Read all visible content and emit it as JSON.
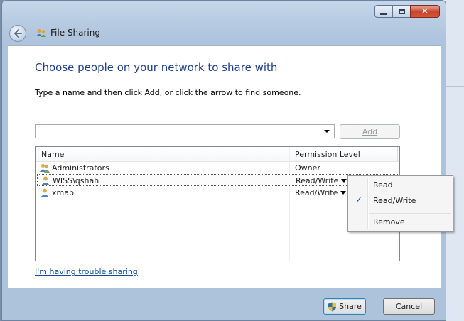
{
  "window": {
    "title": "File Sharing"
  },
  "main": {
    "heading": "Choose people on your network to share with",
    "instruction": "Type a name and then click Add, or click the arrow to find someone.",
    "name_input_value": "",
    "add_label": "Add"
  },
  "list": {
    "columns": {
      "name": "Name",
      "permission": "Permission Level"
    },
    "rows": [
      {
        "name": "Administrators",
        "permission": "Owner",
        "icon": "group-users-icon"
      },
      {
        "name": "WISS\\qshah",
        "permission": "Read/Write",
        "icon": "user-icon"
      },
      {
        "name": "xmap",
        "permission": "Read/Write",
        "icon": "user-icon"
      }
    ]
  },
  "menu": {
    "items": [
      {
        "label": "Read",
        "checked": false
      },
      {
        "label": "Read/Write",
        "checked": true
      },
      {
        "label": "Remove",
        "checked": false
      }
    ],
    "check_glyph": "✓"
  },
  "links": {
    "trouble": "I'm having trouble sharing"
  },
  "buttons": {
    "share": "Share",
    "cancel": "Cancel"
  },
  "colors": {
    "heading": "#1e3f8e",
    "link": "#0f4ea3",
    "close": "#c8452c"
  }
}
